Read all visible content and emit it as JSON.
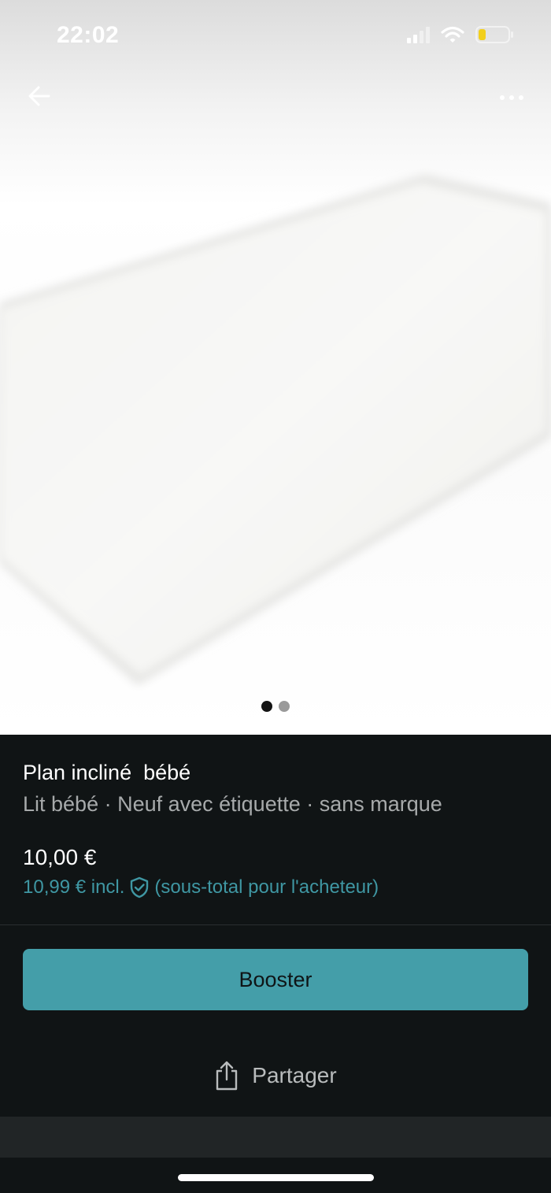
{
  "status_bar": {
    "time": "22:02",
    "icons": [
      "signal-icon",
      "wifi-icon",
      "battery-icon"
    ],
    "battery_color": "#f2cf1c"
  },
  "nav": {
    "back_icon": "arrow-left-icon",
    "more_icon": "more-horizontal-icon"
  },
  "gallery": {
    "image_count": 2,
    "current_index": 1
  },
  "product": {
    "title": "Plan incliné  bébé",
    "subtitle": "Lit bébé · Neuf avec étiquette · sans marque",
    "price": "10,00 €",
    "buyer_price": "10,99 € incl.",
    "buyer_note": "(sous-total pour l'acheteur)",
    "buyer_icon": "shield-check-icon"
  },
  "actions": {
    "boost_label": "Booster",
    "share_label": "Partager",
    "share_icon": "share-icon"
  },
  "colors": {
    "accent": "#449ea9",
    "accent_text": "#3f97a3",
    "background": "#101415"
  }
}
